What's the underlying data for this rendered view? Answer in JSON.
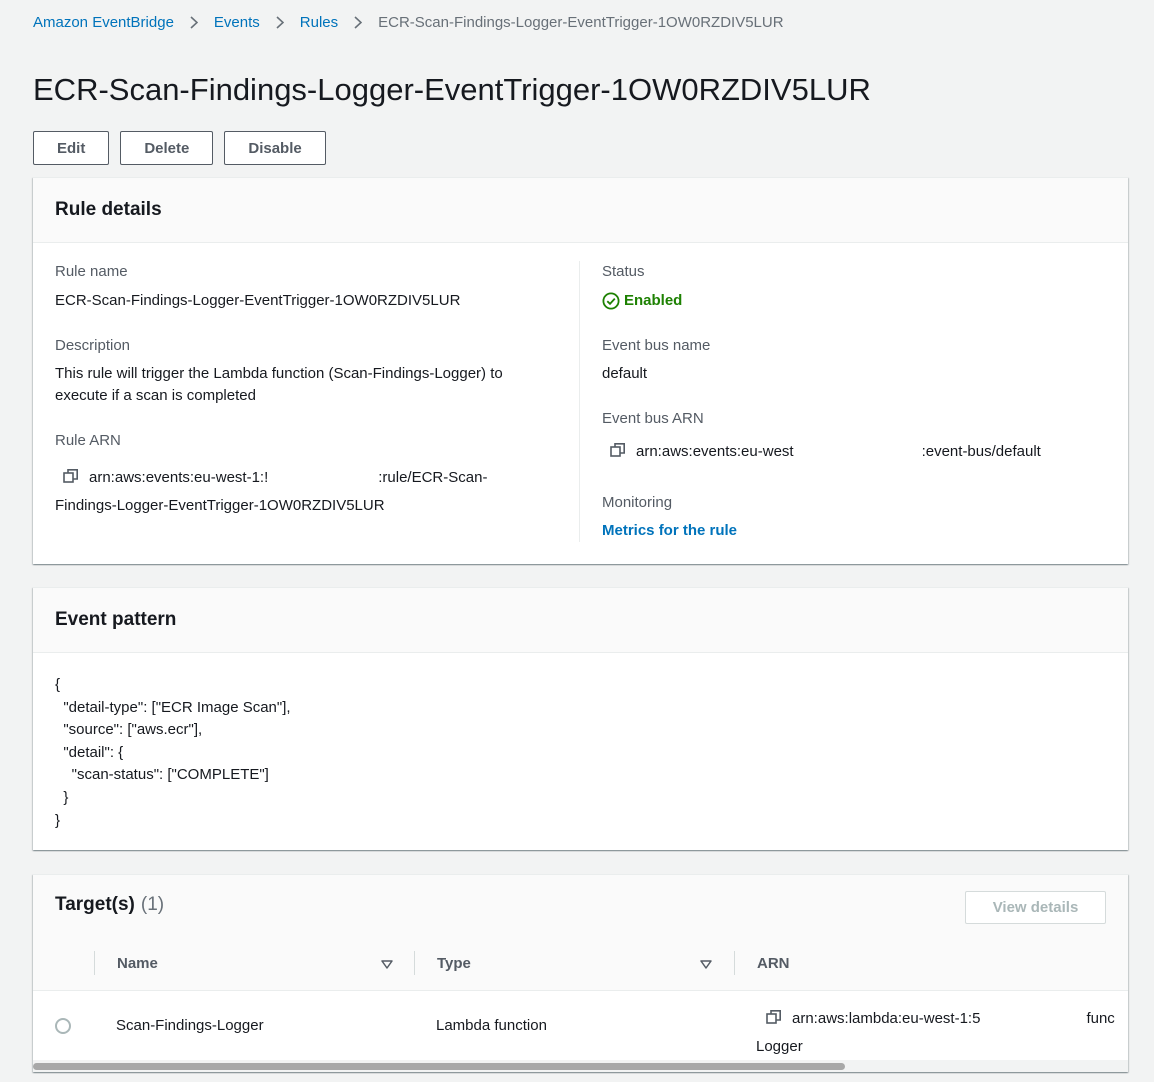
{
  "breadcrumb": {
    "items": [
      "Amazon EventBridge",
      "Events",
      "Rules"
    ],
    "current": "ECR-Scan-Findings-Logger-EventTrigger-1OW0RZDIV5LUR"
  },
  "page": {
    "title": "ECR-Scan-Findings-Logger-EventTrigger-1OW0RZDIV5LUR"
  },
  "actions": {
    "edit": "Edit",
    "delete": "Delete",
    "disable": "Disable"
  },
  "rule_details": {
    "heading": "Rule details",
    "rule_name_label": "Rule name",
    "rule_name": "ECR-Scan-Findings-Logger-EventTrigger-1OW0RZDIV5LUR",
    "description_label": "Description",
    "description_line1": "This rule will trigger the Lambda function (Scan-Findings-Logger) to",
    "description_line2": "execute if a scan is completed",
    "rule_arn_label": "Rule ARN",
    "rule_arn_part1": "arn:aws:events:eu-west-1:!",
    "rule_arn_part2": ":rule/ECR-Scan-",
    "rule_arn_line2": "Findings-Logger-EventTrigger-1OW0RZDIV5LUR",
    "status_label": "Status",
    "status": "Enabled",
    "event_bus_name_label": "Event bus name",
    "event_bus_name": "default",
    "event_bus_arn_label": "Event bus ARN",
    "event_bus_arn_part1": "arn:aws:events:eu-west",
    "event_bus_arn_part2": ":event-bus/default",
    "monitoring_label": "Monitoring",
    "monitoring_link": "Metrics for the rule"
  },
  "event_pattern": {
    "heading": "Event pattern",
    "code": "{\n  \"detail-type\": [\"ECR Image Scan\"],\n  \"source\": [\"aws.ecr\"],\n  \"detail\": {\n    \"scan-status\": [\"COMPLETE\"]\n  }\n}"
  },
  "targets": {
    "heading": "Target(s)",
    "count": "(1)",
    "view_details": "View details",
    "columns": {
      "name": "Name",
      "type": "Type",
      "arn": "ARN"
    },
    "rows": [
      {
        "name": "Scan-Findings-Logger",
        "type": "Lambda function",
        "arn_part1": "arn:aws:lambda:eu-west-1:5",
        "arn_part2": "func",
        "arn_line2": "Logger"
      }
    ]
  },
  "colors": {
    "link": "#0073bb",
    "success": "#1d8102",
    "background": "#f2f3f3"
  },
  "icons": [
    "chevron-right-icon",
    "copy-icon",
    "status-check-icon",
    "sort-down-icon",
    "radio-icon"
  ]
}
